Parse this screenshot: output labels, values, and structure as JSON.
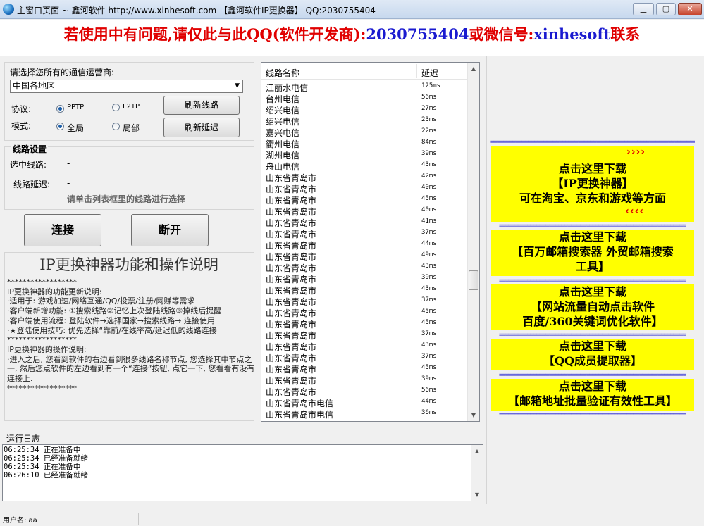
{
  "window": {
    "title": "主窗口页面 ~ 鑫河软件 http://www.xinhesoft.com 【鑫河软件IP更换器】 QQ:2030755404",
    "min_label": "▁",
    "max_label": "▢",
    "close_label": "✕"
  },
  "banner": {
    "part1": "若使用中有问题,请仅此与此QQ(软件开发商):",
    "qq": "2030755404",
    "part2": "或微信号:",
    "wechat": "xinhesoft",
    "part3": "联系"
  },
  "carrier": {
    "label": "请选择您所有的通信运营商:",
    "selected": "中国各地区"
  },
  "protocol": {
    "label": "协议:",
    "options": [
      "PPTP",
      "L2TP"
    ],
    "selected": "PPTP"
  },
  "mode": {
    "label": "模式:",
    "options": [
      "全局",
      "局部"
    ],
    "selected": "全局"
  },
  "buttons": {
    "refresh_lines": "刷新线路",
    "refresh_latency": "刷新延迟",
    "connect": "连接",
    "disconnect": "断开"
  },
  "line_settings": {
    "title": "线路设置",
    "selected_label": "选中线路:",
    "selected_value": "-",
    "latency_label": "线路延迟:",
    "latency_value": "-",
    "hint": "请单击列表框里的线路进行选择"
  },
  "description": {
    "title": "IP更换神器功能和操作说明",
    "lines": [
      "******************",
      "IP更换神器的功能更新说明:",
      "·适用于: 游戏加速/网络互通/QQ/投票/注册/网赚等需求",
      "·客户端新增功能: ①搜索线路②记忆上次登陆线路③掉线后提醒",
      "·客户端使用流程: 登陆软件→选择国家→搜索线路→ 连接使用",
      "·★登陆使用技巧: 优先选择“靠前/在线率高/延迟低的线路连接",
      "******************",
      "IP更换神器的操作说明:",
      "·进入之后, 您看到软件的右边看到很多线路名称节点, 您选择其中节点之一, 然后您点软件的左边看到有一个“连接”按钮, 点它一下, 您看看有没有连接上.",
      "******************"
    ]
  },
  "line_list": {
    "col_name": "线路名称",
    "col_latency": "延迟",
    "rows": [
      {
        "name": "江丽水电信",
        "latency": "125ms"
      },
      {
        "name": "台州电信",
        "latency": "56ms"
      },
      {
        "name": "绍兴电信",
        "latency": "27ms"
      },
      {
        "name": "绍兴电信",
        "latency": "23ms"
      },
      {
        "name": "嘉兴电信",
        "latency": "22ms"
      },
      {
        "name": "衢州电信",
        "latency": "84ms"
      },
      {
        "name": "湖州电信",
        "latency": "39ms"
      },
      {
        "name": "舟山电信",
        "latency": "43ms"
      },
      {
        "name": "山东省青岛市",
        "latency": "42ms"
      },
      {
        "name": "山东省青岛市",
        "latency": "40ms"
      },
      {
        "name": "山东省青岛市",
        "latency": "45ms"
      },
      {
        "name": "山东省青岛市",
        "latency": "40ms"
      },
      {
        "name": "山东省青岛市",
        "latency": "41ms"
      },
      {
        "name": "山东省青岛市",
        "latency": "37ms"
      },
      {
        "name": "山东省青岛市",
        "latency": "44ms"
      },
      {
        "name": "山东省青岛市",
        "latency": "49ms"
      },
      {
        "name": "山东省青岛市",
        "latency": "43ms"
      },
      {
        "name": "山东省青岛市",
        "latency": "39ms"
      },
      {
        "name": "山东省青岛市",
        "latency": "43ms"
      },
      {
        "name": "山东省青岛市",
        "latency": "37ms"
      },
      {
        "name": "山东省青岛市",
        "latency": "45ms"
      },
      {
        "name": "山东省青岛市",
        "latency": "45ms"
      },
      {
        "name": "山东省青岛市",
        "latency": "37ms"
      },
      {
        "name": "山东省青岛市",
        "latency": "43ms"
      },
      {
        "name": "山东省青岛市",
        "latency": "37ms"
      },
      {
        "name": "山东省青岛市",
        "latency": "45ms"
      },
      {
        "name": "山东省青岛市",
        "latency": "39ms"
      },
      {
        "name": "山东省青岛市",
        "latency": "56ms"
      },
      {
        "name": "山东省青岛市电信",
        "latency": "44ms"
      },
      {
        "name": "山东省青岛市电信",
        "latency": "36ms"
      }
    ]
  },
  "ads": {
    "separator": "==============================================================================",
    "arrows_right": "››››",
    "arrows_left": "‹‹‹‹",
    "items": [
      {
        "lines": [
          "点击这里下载",
          "【IP更换神器】",
          "可在淘宝、京东和游戏等方面"
        ]
      },
      {
        "lines": [
          "点击这里下载",
          "【百万邮箱搜索器 外贸邮箱搜索",
          "工具】"
        ]
      },
      {
        "lines": [
          "点击这里下载",
          "【网站流量自动点击软件",
          "百度/360关键词优化软件】"
        ]
      },
      {
        "lines": [
          "点击这里下载",
          "【QQ成员提取器】"
        ]
      },
      {
        "lines": [
          "点击这里下载",
          "【邮箱地址批量验证有效性工具】"
        ]
      }
    ]
  },
  "log": {
    "label": "运行日志",
    "lines": [
      "06:25:34 正在准备中",
      "06:25:34 已经准备就绪",
      "06:25:34 正在准备中",
      "06:26:10 已经准备就绪"
    ]
  },
  "status": {
    "user_label": "用户名: aa"
  },
  "colors": {
    "banner_red": "#e00000",
    "banner_blue": "#1a1ad0",
    "ad_bg": "#ffff00"
  }
}
